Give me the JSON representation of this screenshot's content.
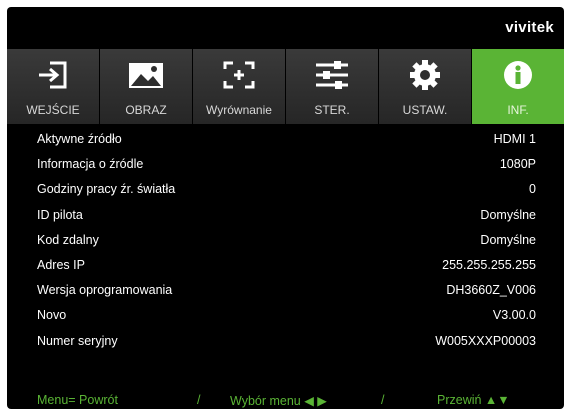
{
  "brand": "vivitek",
  "tabs": [
    {
      "label": "WEJŚCIE",
      "icon": "input-icon",
      "active": false
    },
    {
      "label": "OBRAZ",
      "icon": "image-icon",
      "active": false
    },
    {
      "label": "Wyrównanie",
      "icon": "alignment-icon",
      "active": false
    },
    {
      "label": "STER.",
      "icon": "sliders-icon",
      "active": false
    },
    {
      "label": "USTAW.",
      "icon": "gear-icon",
      "active": false
    },
    {
      "label": "INF.",
      "icon": "info-icon",
      "active": true
    }
  ],
  "info": [
    {
      "label": "Aktywne źródło",
      "value": "HDMI 1"
    },
    {
      "label": "Informacja o źródle",
      "value": "1080P"
    },
    {
      "label": "Godziny pracy źr. światła",
      "value": "0"
    },
    {
      "label": "ID pilota",
      "value": "Domyślne"
    },
    {
      "label": "Kod zdalny",
      "value": "Domyślne"
    },
    {
      "label": "Adres IP",
      "value": "255.255.255.255"
    },
    {
      "label": "Wersja oprogramowania",
      "value": "DH3660Z_V006"
    },
    {
      "label": "Novo",
      "value": "V3.00.0"
    },
    {
      "label": "Numer seryjny",
      "value": "W005XXXP00003"
    }
  ],
  "footer": {
    "menu": "Menu= Powrót",
    "sep1": "/",
    "select": "Wybór menu ◀ ▶",
    "sep2": "/",
    "scroll": "Przewiń ▲▼"
  },
  "colors": {
    "accent": "#5ab435",
    "background": "#000000",
    "tab": "#2e2e2e",
    "text": "#ffffff"
  }
}
